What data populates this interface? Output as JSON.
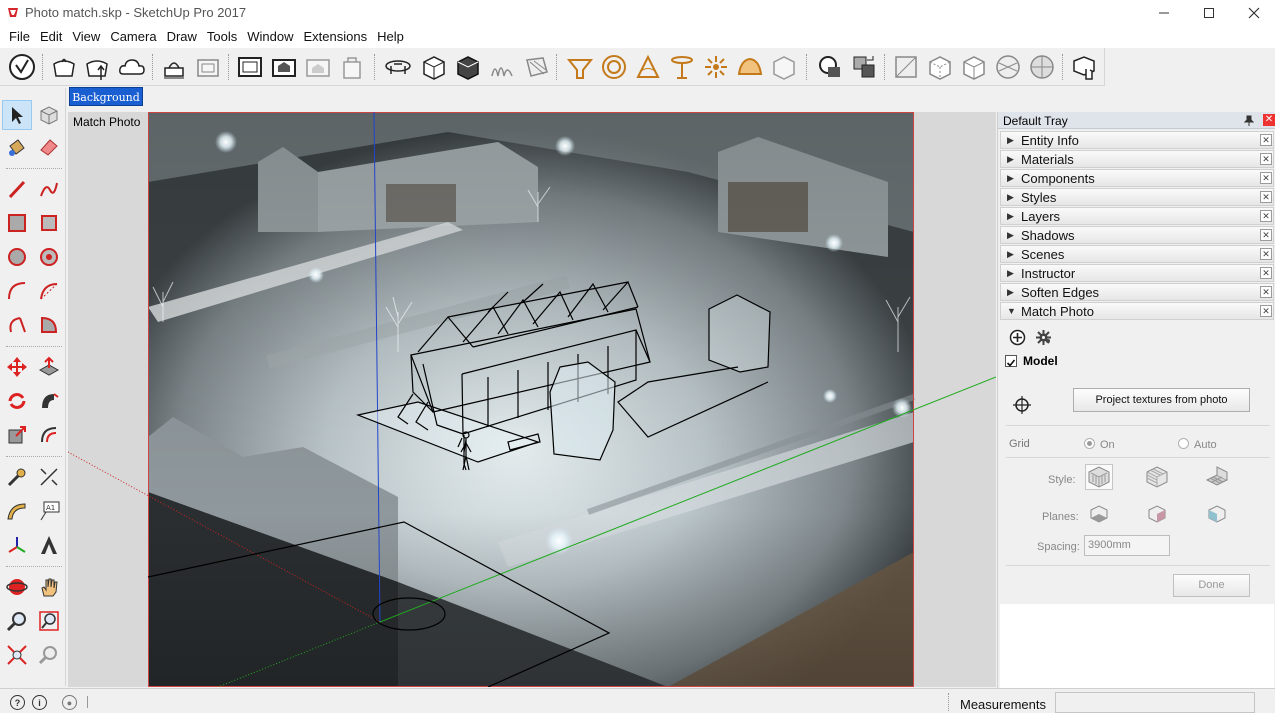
{
  "window": {
    "title": "Photo match.skp - SketchUp Pro 2017",
    "app_icon": "sketchup-logo-icon",
    "controls": [
      "minimize-icon",
      "maximize-icon",
      "close-icon"
    ]
  },
  "menu": [
    "File",
    "Edit",
    "View",
    "Camera",
    "Draw",
    "Tools",
    "Window",
    "Extensions",
    "Help"
  ],
  "toolbar": {
    "tools": [
      "warehouse-icon",
      "extension-manager-icon",
      "share-model-icon",
      "cloud-icon",
      "generate-report-icon",
      "layout-icon",
      "section-plane-icon",
      "display-section-icon",
      "display-section-cut-icon",
      "section-fill-icon",
      "sandbox-from-contours-icon",
      "sandbox-from-scratch-icon",
      "smoove-icon",
      "stamp-icon",
      "drape-icon",
      "add-detail-icon",
      "flip-edge-icon",
      "perspective-icon",
      "camera-position-icon",
      "look-around-icon",
      "walk-icon",
      "make-component-icon",
      "solid-outer-shell-icon",
      "solid-intersect-icon",
      "xray-icon",
      "back-edges-icon",
      "wireframe-icon",
      "hidden-line-icon",
      "shaded-icon",
      "shaded-textures-icon",
      "monochrome-icon",
      "advanced-camera-icon"
    ]
  },
  "left_tools": [
    "select-icon",
    "make-component-icon",
    "paint-bucket-icon",
    "eraser-icon",
    "line-icon",
    "freehand-icon",
    "rectangle-icon",
    "rotated-rectangle-icon",
    "circle-icon",
    "polygon-icon",
    "arc-icon",
    "two-point-arc-icon",
    "three-point-arc-icon",
    "pie-icon",
    "move-icon",
    "push-pull-icon",
    "rotate-icon",
    "follow-me-icon",
    "scale-icon",
    "offset-icon",
    "tape-measure-icon",
    "dimension-icon",
    "protractor-icon",
    "text-icon",
    "axes-icon",
    "3d-text-icon",
    "orbit-icon",
    "pan-icon",
    "zoom-icon",
    "zoom-window-icon",
    "zoom-extents-icon",
    "previous-view-icon"
  ],
  "scene_tab": {
    "label": "Background"
  },
  "viewport": {
    "label": "Match Photo"
  },
  "tray": {
    "title": "Default Tray",
    "pin_icon": "pin-icon",
    "close_icon": "close-icon",
    "panels": [
      {
        "title": "Entity Info",
        "expanded": false
      },
      {
        "title": "Materials",
        "expanded": false
      },
      {
        "title": "Components",
        "expanded": false
      },
      {
        "title": "Styles",
        "expanded": false
      },
      {
        "title": "Layers",
        "expanded": false
      },
      {
        "title": "Shadows",
        "expanded": false
      },
      {
        "title": "Scenes",
        "expanded": false
      },
      {
        "title": "Instructor",
        "expanded": false
      },
      {
        "title": "Soften Edges",
        "expanded": false
      },
      {
        "title": "Match Photo",
        "expanded": true
      }
    ],
    "match_photo": {
      "model_label": "Model",
      "model_checked": true,
      "project_textures_label": "Project textures from photo",
      "grid_label": "Grid",
      "grid_on_label": "On",
      "grid_auto_label": "Auto",
      "style_label": "Style:",
      "planes_label": "Planes:",
      "spacing_label": "Spacing:",
      "spacing_value": "3900mm",
      "done_label": "Done"
    }
  },
  "statusbar": {
    "measurements_label": "Measurements",
    "measurements_value": ""
  },
  "colors": {
    "accent_tab": "#1a5fd1",
    "toolbar_orange": "#c47a1a",
    "axis_red": "#cc2222",
    "axis_green": "#22aa22",
    "axis_blue": "#2244cc"
  }
}
